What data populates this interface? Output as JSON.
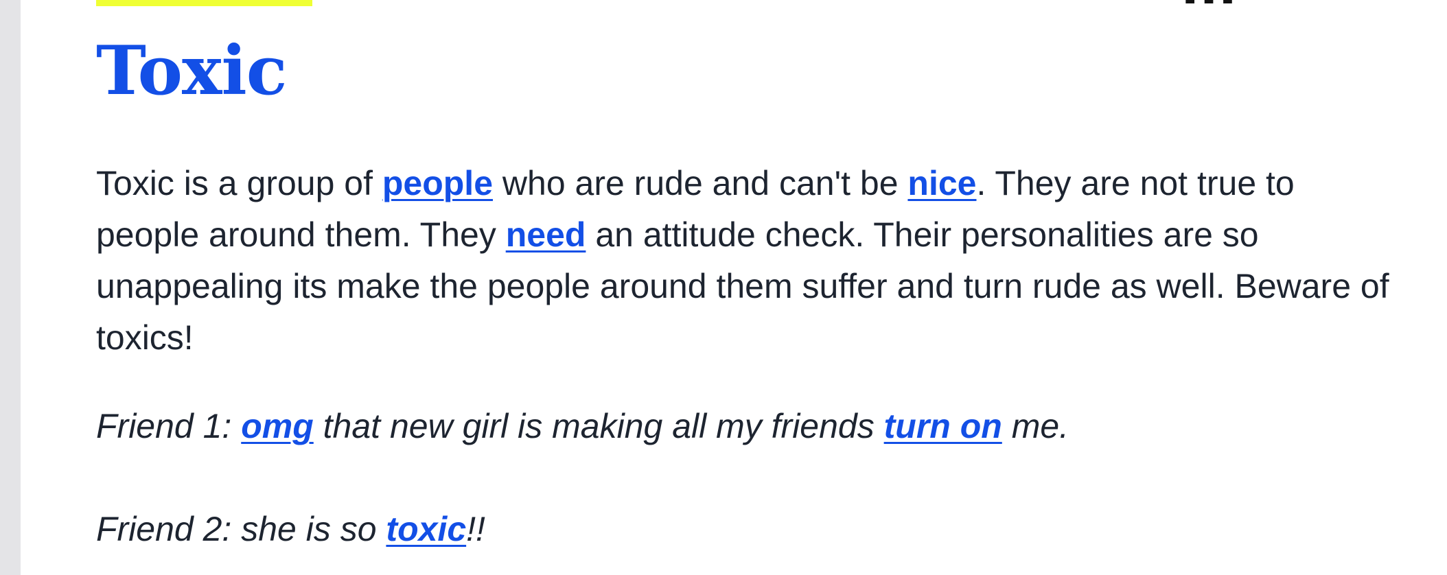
{
  "colors": {
    "link": "#134fe6",
    "accent_bar": "#efff34",
    "body_text": "#1d2430",
    "left_rail": "#e4e4e7"
  },
  "header": {
    "partial_text": "..."
  },
  "entry": {
    "word": "Toxic",
    "definition": {
      "t1": "Toxic is a group of ",
      "l1": "people",
      "t2": " who are rude and can't be ",
      "l2": "nice",
      "t3": ". They are not true to people around them. They ",
      "l3": "need",
      "t4": " an attitude check. Their personalities are so unappealing its make the people around them suffer and turn rude as well. Beware of toxics!"
    },
    "example": {
      "line1": {
        "t1": "Friend 1: ",
        "l1": "omg",
        "t2": " that new girl is making all my friends ",
        "l2": "turn on",
        "t3": " me."
      },
      "line2": {
        "t1": "Friend 2: she is so ",
        "l1": "toxic",
        "t2": "!!"
      }
    }
  }
}
